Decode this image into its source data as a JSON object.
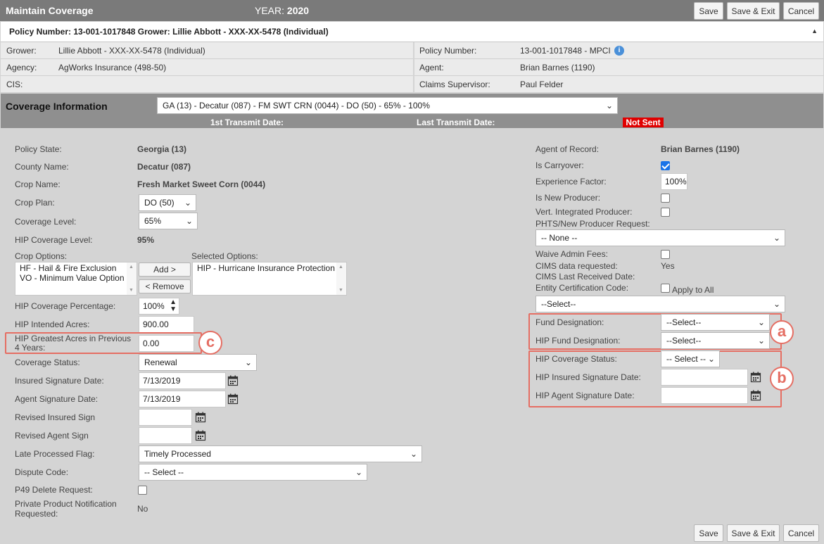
{
  "header": {
    "title": "Maintain Coverage",
    "year_label": "YEAR:",
    "year_value": "2020",
    "save": "Save",
    "save_exit": "Save & Exit",
    "cancel": "Cancel"
  },
  "policy_summary": "Policy Number: 13-001-1017848 Grower: Lillie Abbott - XXX-XX-5478 (Individual)",
  "info": {
    "grower_label": "Grower:",
    "grower_value": "Lillie Abbott - XXX-XX-5478 (Individual)",
    "policy_label": "Policy Number:",
    "policy_value": "13-001-1017848 - MPCI",
    "agency_label": "Agency:",
    "agency_value": "AgWorks Insurance (498-50)",
    "agent_label": "Agent:",
    "agent_value": "Brian Barnes (1190)",
    "cis_label": "CIS:",
    "claims_label": "Claims Supervisor:",
    "claims_value": "Paul Felder"
  },
  "coverage": {
    "title": "Coverage Information",
    "selected": "GA (13) - Decatur (087) - FM SWT CRN (0044) - DO (50) - 65% - 100%",
    "first_transmit_label": "1st Transmit Date:",
    "last_transmit_label": "Last Transmit Date:",
    "status_badge": "Not Sent"
  },
  "left": {
    "policy_state_label": "Policy State:",
    "policy_state_value": "Georgia (13)",
    "county_label": "County Name:",
    "county_value": "Decatur (087)",
    "crop_name_label": "Crop Name:",
    "crop_name_value": "Fresh Market Sweet Corn (0044)",
    "crop_plan_label": "Crop Plan:",
    "crop_plan_value": "DO (50)",
    "coverage_level_label": "Coverage Level:",
    "coverage_level_value": "65%",
    "hip_cov_level_label": "HIP Coverage Level:",
    "hip_cov_level_value": "95%",
    "crop_options_label": "Crop Options:",
    "crop_options": [
      "HF - Hail & Fire Exclusion",
      "VO - Minimum Value Option"
    ],
    "selected_options_label": "Selected Options:",
    "selected_options": [
      "HIP - Hurricane Insurance Protection"
    ],
    "add_button": "Add >",
    "remove_button": "< Remove",
    "hip_cov_pct_label": "HIP Coverage Percentage:",
    "hip_cov_pct_value": "100%",
    "hip_intended_label": "HIP Intended Acres:",
    "hip_intended_value": "900.00",
    "hip_greatest_label": "HIP Greatest Acres in Previous 4 Years:",
    "hip_greatest_value": "0.00",
    "coverage_status_label": "Coverage Status:",
    "coverage_status_value": "Renewal",
    "insured_sig_label": "Insured Signature Date:",
    "insured_sig_value": "7/13/2019",
    "agent_sig_label": "Agent Signature Date:",
    "agent_sig_value": "7/13/2019",
    "revised_insured_label": "Revised Insured Sign",
    "revised_agent_label": "Revised Agent Sign",
    "late_flag_label": "Late Processed Flag:",
    "late_flag_value": "Timely Processed",
    "dispute_label": "Dispute Code:",
    "dispute_value": "-- Select --",
    "p49_label": "P49 Delete Request:",
    "private_label": "Private Product Notification Requested:",
    "private_value": "No"
  },
  "right": {
    "agent_record_label": "Agent of Record:",
    "agent_record_value": "Brian Barnes (1190)",
    "carryover_label": "Is Carryover:",
    "experience_label": "Experience Factor:",
    "experience_value": "100%",
    "new_producer_label": "Is New Producer:",
    "vert_label": "Vert. Integrated Producer:",
    "phts_label": "PHTS/New Producer Request:",
    "phts_value": "-- None --",
    "waive_label": "Waive Admin Fees:",
    "cims_req_label": "CIMS data requested:",
    "cims_req_value": "Yes",
    "cims_last_label": "CIMS Last Received Date:",
    "entity_label": "Entity Certification Code:",
    "apply_all_label": "Apply to All",
    "entity_value": "--Select--",
    "fund_label": "Fund Designation:",
    "fund_value": "--Select--",
    "hip_fund_label": "HIP Fund Designation:",
    "hip_fund_value": "--Select--",
    "hip_status_label": "HIP Coverage Status:",
    "hip_status_value": "-- Select --",
    "hip_insured_sig_label": "HIP Insured Signature Date:",
    "hip_agent_sig_label": "HIP Agent Signature Date:"
  },
  "callouts": {
    "a": "a",
    "b": "b",
    "c": "c"
  },
  "colors": {
    "title_bar": "#7a7a7a",
    "coverage_bar": "#8f8f8f",
    "callout": "#e56e63",
    "not_sent": "#e00000",
    "checkbox_on": "#1a73e8"
  }
}
